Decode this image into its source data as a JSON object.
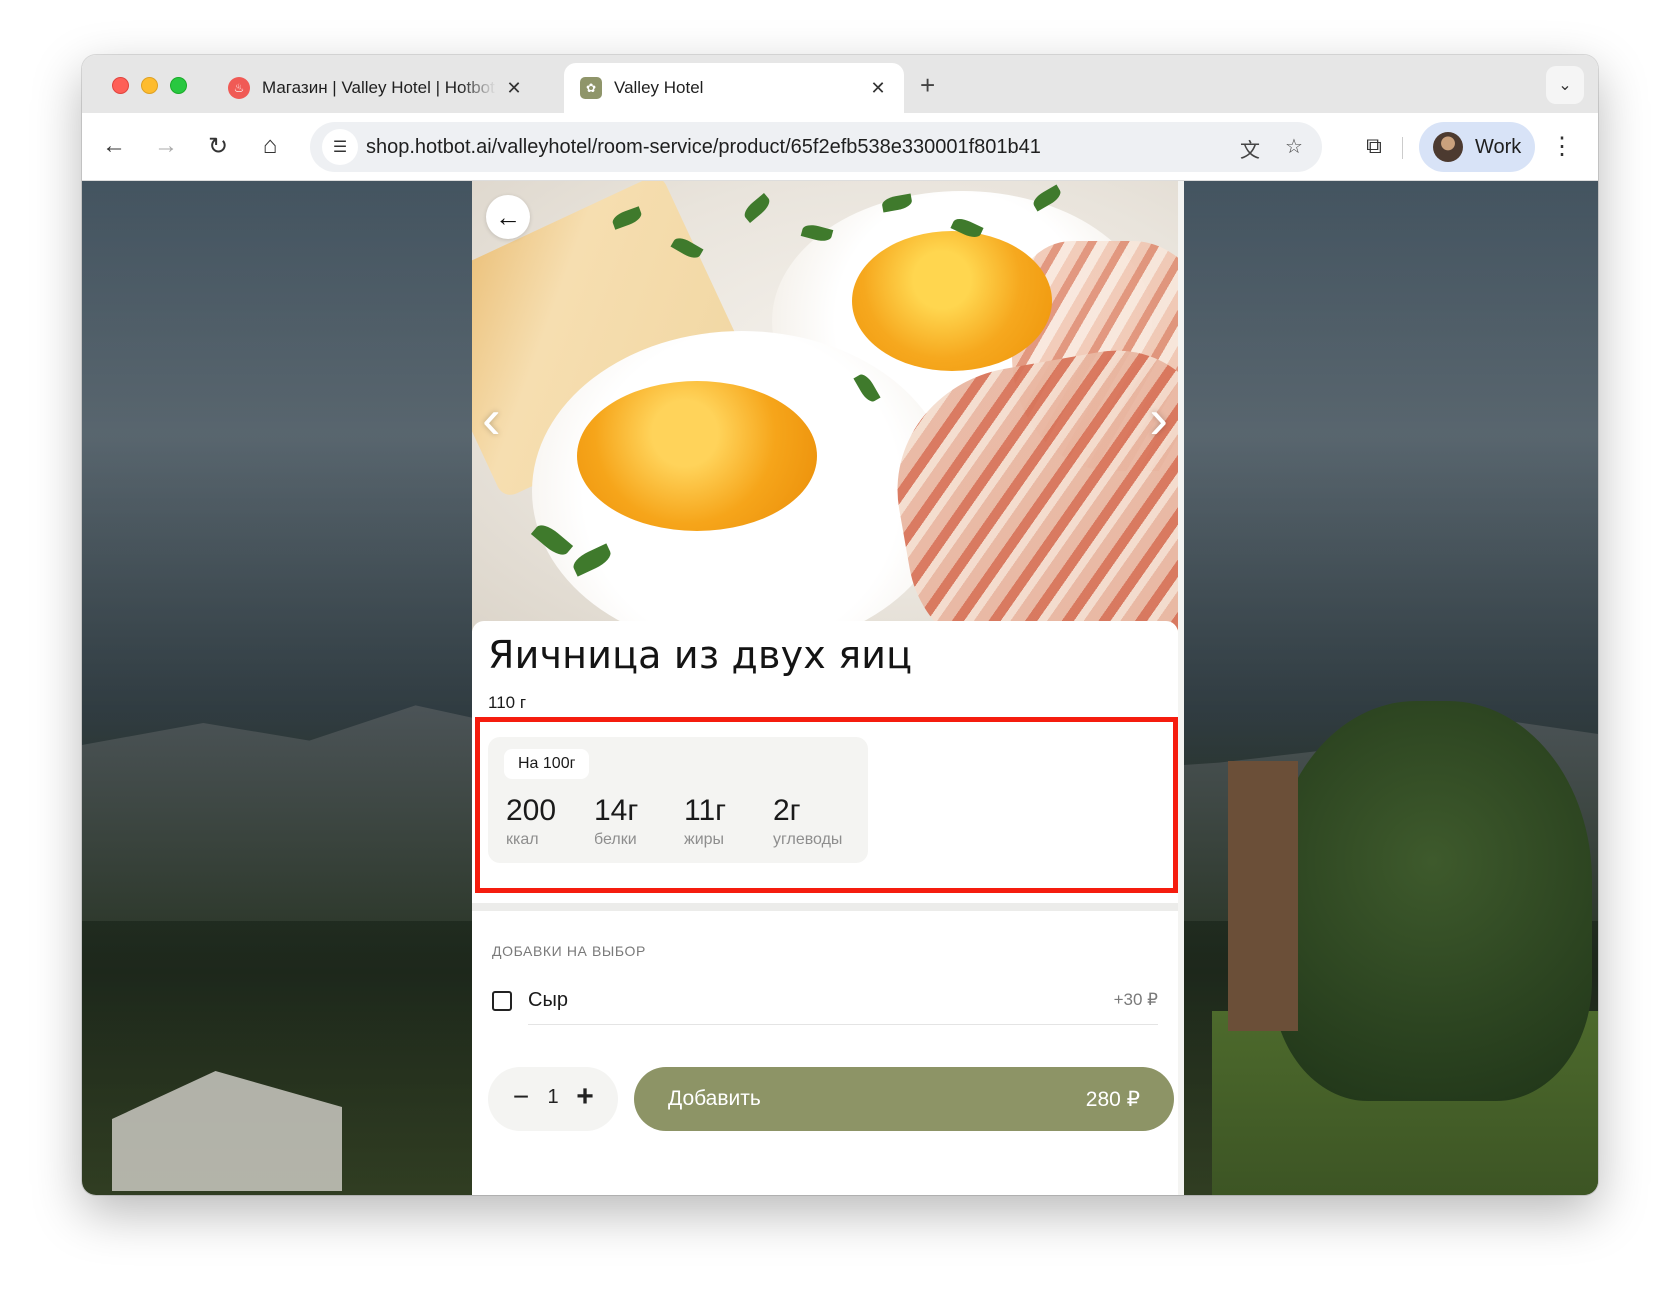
{
  "browser": {
    "tabs": [
      {
        "title": "Магазин | Valley Hotel | Hotbot",
        "favicon": "hotbot-flame-icon"
      },
      {
        "title": "Valley Hotel",
        "favicon": "valley-hotel-logo-icon"
      }
    ],
    "url": "shop.hotbot.ai/valleyhotel/room-service/product/65f2efb538e330001f801b41",
    "profile_label": "Work"
  },
  "product": {
    "title": "Яичница из двух яиц",
    "weight": "110 г",
    "nutrition": {
      "per_label": "На 100г",
      "items": [
        {
          "value": "200",
          "label": "ккал"
        },
        {
          "value": "14г",
          "label": "белки"
        },
        {
          "value": "11г",
          "label": "жиры"
        },
        {
          "value": "2г",
          "label": "углеводы"
        }
      ]
    },
    "options_title": "ДОБАВКИ НА ВЫБОР",
    "options": [
      {
        "label": "Сыр",
        "price": "+30 ₽",
        "checked": false
      }
    ],
    "quantity": "1",
    "add_button": {
      "label": "Добавить",
      "price": "280 ₽"
    },
    "carousel": {
      "slides": 2,
      "active": 1
    }
  },
  "colors": {
    "accent": "#8d9466",
    "highlight": "#f51c0e"
  }
}
